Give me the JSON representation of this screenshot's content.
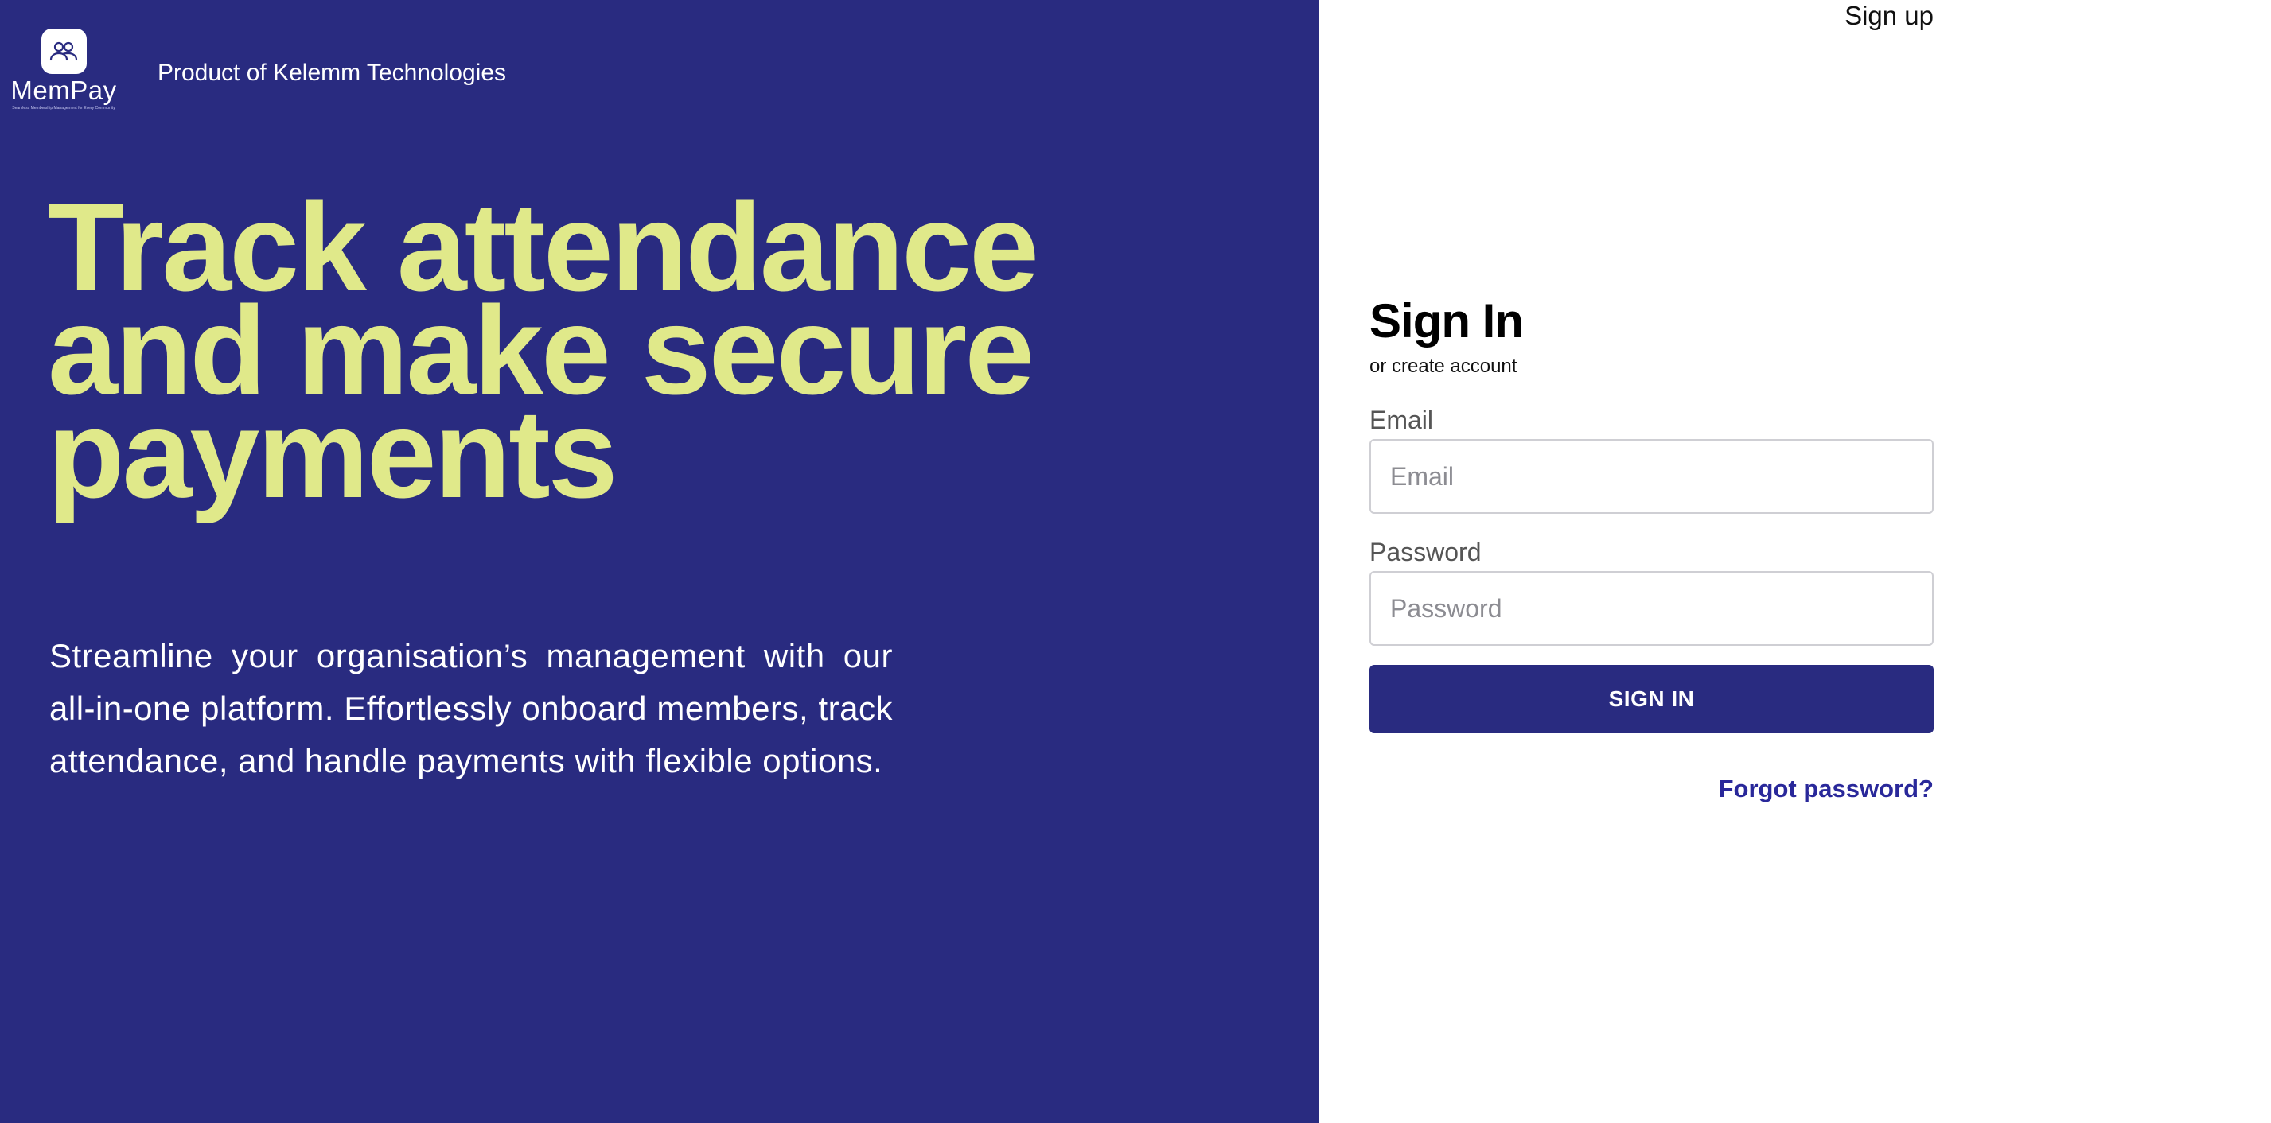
{
  "brand": {
    "logo_icon": "users-icon",
    "logo_name": "MemPay",
    "logo_tagline": "Seamless Membership Management for Every Community",
    "product_of": "Product of Kelemm Technologies"
  },
  "hero": {
    "headline": "Track attendance and make secure payments",
    "description": "Streamline your organisation’s management with our all-in-one platform. Effortlessly onboard members, track attendance, and handle payments with flexible options."
  },
  "header": {
    "signup_label": "Sign up"
  },
  "signin": {
    "title": "Sign In",
    "subtitle": "or create account",
    "email_label": "Email",
    "email_placeholder": "Email",
    "email_value": "",
    "password_label": "Password",
    "password_placeholder": "Password",
    "password_value": "",
    "button_label": "SIGN IN",
    "forgot_label": "Forgot password?"
  },
  "colors": {
    "brand_navy": "#292b80",
    "headline_yellow": "#e0e98a",
    "link_blue": "#29289a",
    "background": "#ffffff"
  }
}
